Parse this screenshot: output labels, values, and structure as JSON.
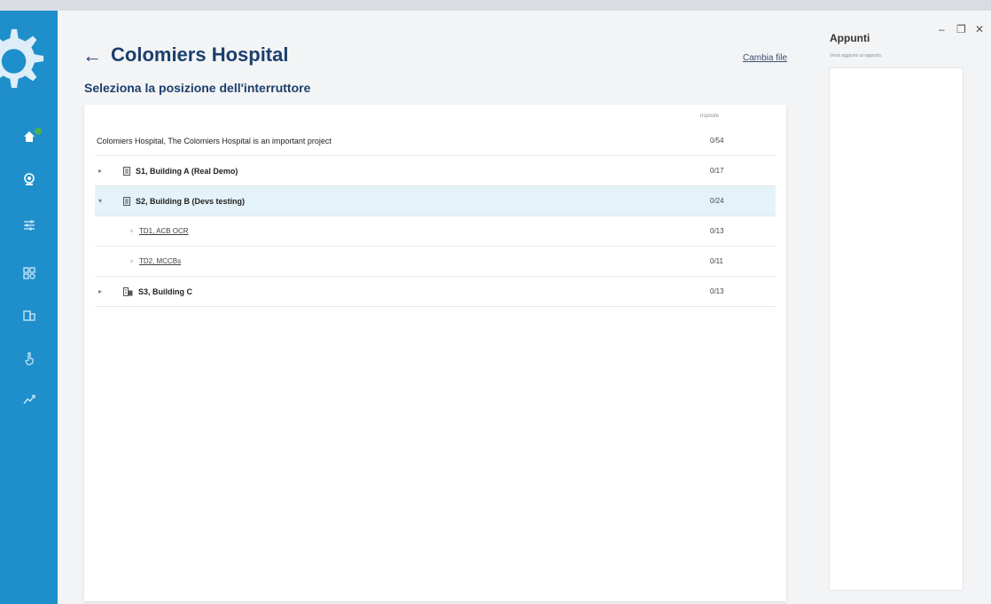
{
  "page": {
    "title": "Colomiers Hospital",
    "subtitle": "Seleziona la posizione dell'interruttore",
    "change_file": "Cambia file"
  },
  "table": {
    "column_header": "risposte",
    "project": {
      "label": "Colomiers Hospital, The Colomiers Hospital is an important project",
      "count": "0/54"
    },
    "rows": [
      {
        "label": "S1, Building A (Real Demo)",
        "count": "0/17",
        "expanded": false
      },
      {
        "label": "S2, Building B (Devs testing)",
        "count": "0/24",
        "expanded": true
      },
      {
        "label": "TD1, ACB OCR",
        "count": "0/13",
        "leaf": true
      },
      {
        "label": "TD2, MCCBs",
        "count": "0/11",
        "leaf": true
      },
      {
        "label": "S3, Building C",
        "count": "0/13",
        "expanded": false
      }
    ]
  },
  "notes": {
    "title": "Appunti",
    "placeholder": "Verrà aggiunto al rapporto."
  },
  "window_controls": {
    "minimize": "–",
    "restore": "❐",
    "close": "✕"
  },
  "icons": {
    "sidebar": [
      "home-icon",
      "scan-icon",
      "sliders-icon",
      "grid-icon",
      "device-icon",
      "pointer-icon",
      "chart-icon"
    ]
  },
  "colors": {
    "sidebar": "#1f8fcc",
    "title": "#1c3f6e",
    "selected_row": "#e3f3f9",
    "status_ok": "#4caf50"
  }
}
